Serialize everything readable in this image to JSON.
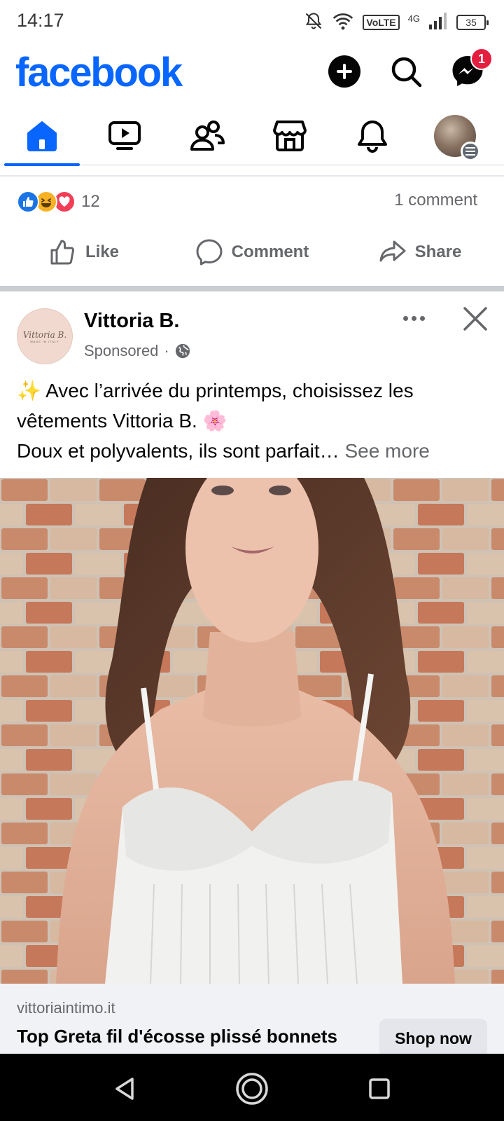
{
  "status_bar": {
    "time": "14:17",
    "volte": "VoLTE",
    "network": "4G",
    "battery": "35"
  },
  "header": {
    "logo": "facebook",
    "messenger_badge": "1",
    "brand_color": "#0866ff"
  },
  "tabs": [
    {
      "name": "home",
      "icon": "home-icon",
      "active": true
    },
    {
      "name": "video",
      "icon": "video-icon",
      "active": false
    },
    {
      "name": "friends",
      "icon": "friends-icon",
      "active": false
    },
    {
      "name": "marketplace",
      "icon": "marketplace-icon",
      "active": false
    },
    {
      "name": "notifications",
      "icon": "bell-icon",
      "active": false
    },
    {
      "name": "profile-menu",
      "icon": "profile-avatar",
      "active": false
    }
  ],
  "prev_post": {
    "reaction_count": "12",
    "comment_count": "1 comment",
    "actions": {
      "like": "Like",
      "comment": "Comment",
      "share": "Share"
    }
  },
  "sponsored_post": {
    "page_name": "Vittoria B.",
    "avatar_text": "Vittoria B.",
    "avatar_subtext": "MADE IN ITALY",
    "sponsored_label": "Sponsored",
    "separator": "·",
    "text_line1": "✨ Avec l’arrivée du printemps, choisissez les vêtements Vittoria B. 🌸",
    "text_line2": "Doux et polyvalents, ils sont parfait…",
    "see_more": "See more",
    "link_domain": "vittoriaintimo.it",
    "link_headline": "Top Greta fil d'écosse plissé bonnets",
    "cta": "Shop now"
  }
}
